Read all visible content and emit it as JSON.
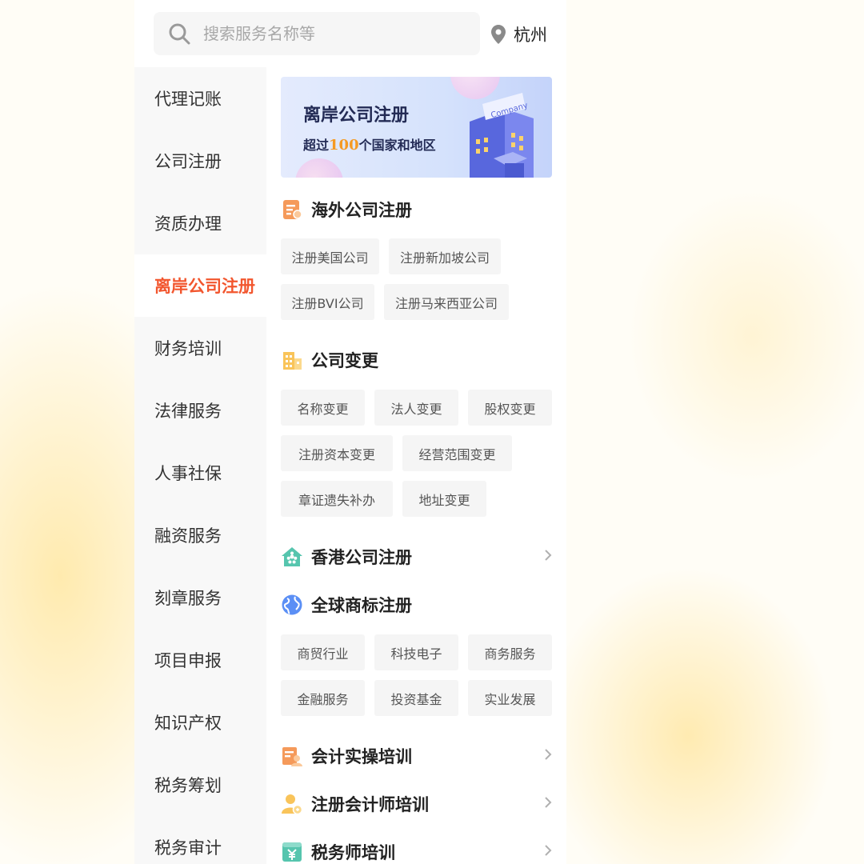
{
  "search": {
    "placeholder": "搜索服务名称等"
  },
  "city": "杭州",
  "sidebar": {
    "items": [
      {
        "label": "代理记账"
      },
      {
        "label": "公司注册"
      },
      {
        "label": "资质办理"
      },
      {
        "label": "离岸公司注册",
        "active": true
      },
      {
        "label": "财务培训"
      },
      {
        "label": "法律服务"
      },
      {
        "label": "人事社保"
      },
      {
        "label": "融资服务"
      },
      {
        "label": "刻章服务"
      },
      {
        "label": "项目申报"
      },
      {
        "label": "知识产权"
      },
      {
        "label": "税务筹划"
      },
      {
        "label": "税务审计"
      }
    ]
  },
  "banner": {
    "title": "离岸公司注册",
    "subtitle_pre": "超过",
    "subtitle_num": "100",
    "subtitle_post": "个国家和地区",
    "building_sign": "Company"
  },
  "sections": {
    "overseas": {
      "title": "海外公司注册",
      "icon": "document-icon",
      "tags": [
        "注册美国公司",
        "注册新加坡公司",
        "注册BVI公司",
        "注册马来西亚公司"
      ]
    },
    "change": {
      "title": "公司变更",
      "icon": "building-icon",
      "tags": [
        "名称变更",
        "法人变更",
        "股权变更",
        "注册资本变更",
        "经营范围变更",
        "章证遗失补办",
        "地址变更"
      ]
    },
    "hongkong": {
      "title": "香港公司注册",
      "icon": "hk-flower-icon"
    },
    "trademark": {
      "title": "全球商标注册",
      "icon": "globe-icon",
      "tags": [
        "商贸行业",
        "科技电子",
        "商务服务",
        "金融服务",
        "投资基金",
        "实业发展"
      ]
    },
    "accounting": {
      "title": "会计实操培训",
      "icon": "accounting-icon"
    },
    "cpa": {
      "title": "注册会计师培训",
      "icon": "cpa-person-icon"
    },
    "tax": {
      "title": "税务师培训",
      "icon": "yuan-box-icon"
    }
  },
  "colors": {
    "accent": "#f2562e",
    "orange_icon": "#f7a35a",
    "yellow_icon": "#f9c45a",
    "teal_icon": "#56c5ae",
    "blue_icon": "#5b8ff5",
    "banner_number": "#f59a23"
  }
}
